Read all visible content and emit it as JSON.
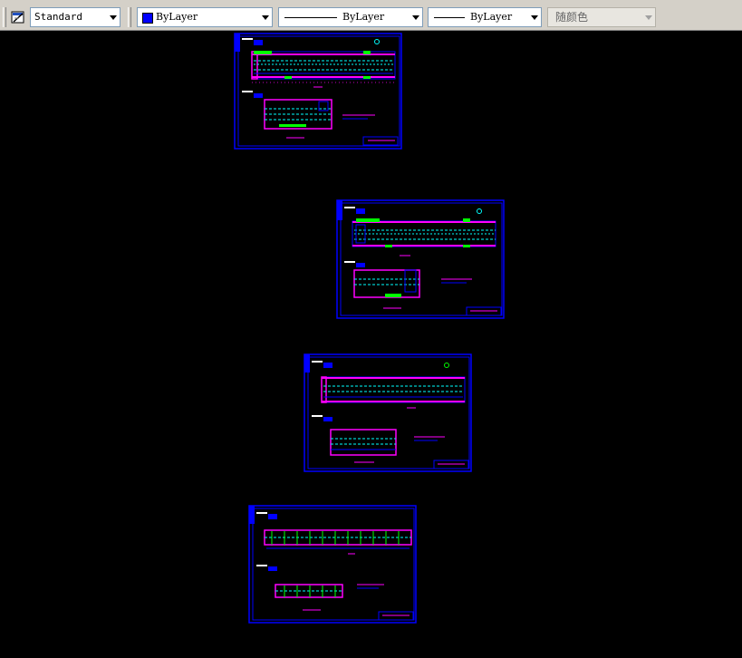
{
  "toolbar": {
    "text_style_icon": "text-style-icon",
    "text_style": "Standard",
    "color_control": {
      "value": "ByLayer",
      "swatch_color": "#0000ff"
    },
    "linetype_control": {
      "value": "ByLayer"
    },
    "lineweight_control": {
      "value": "ByLayer"
    },
    "plotstyle_control": {
      "value": "随颜色",
      "disabled": true
    }
  },
  "canvas": {
    "background": "#000000",
    "sheet_count": 4
  },
  "colors": {
    "frame": "#0000ff",
    "magenta": "#ff00ff",
    "cyan": "#00ffff",
    "green": "#00ff00",
    "white": "#ffffff"
  }
}
